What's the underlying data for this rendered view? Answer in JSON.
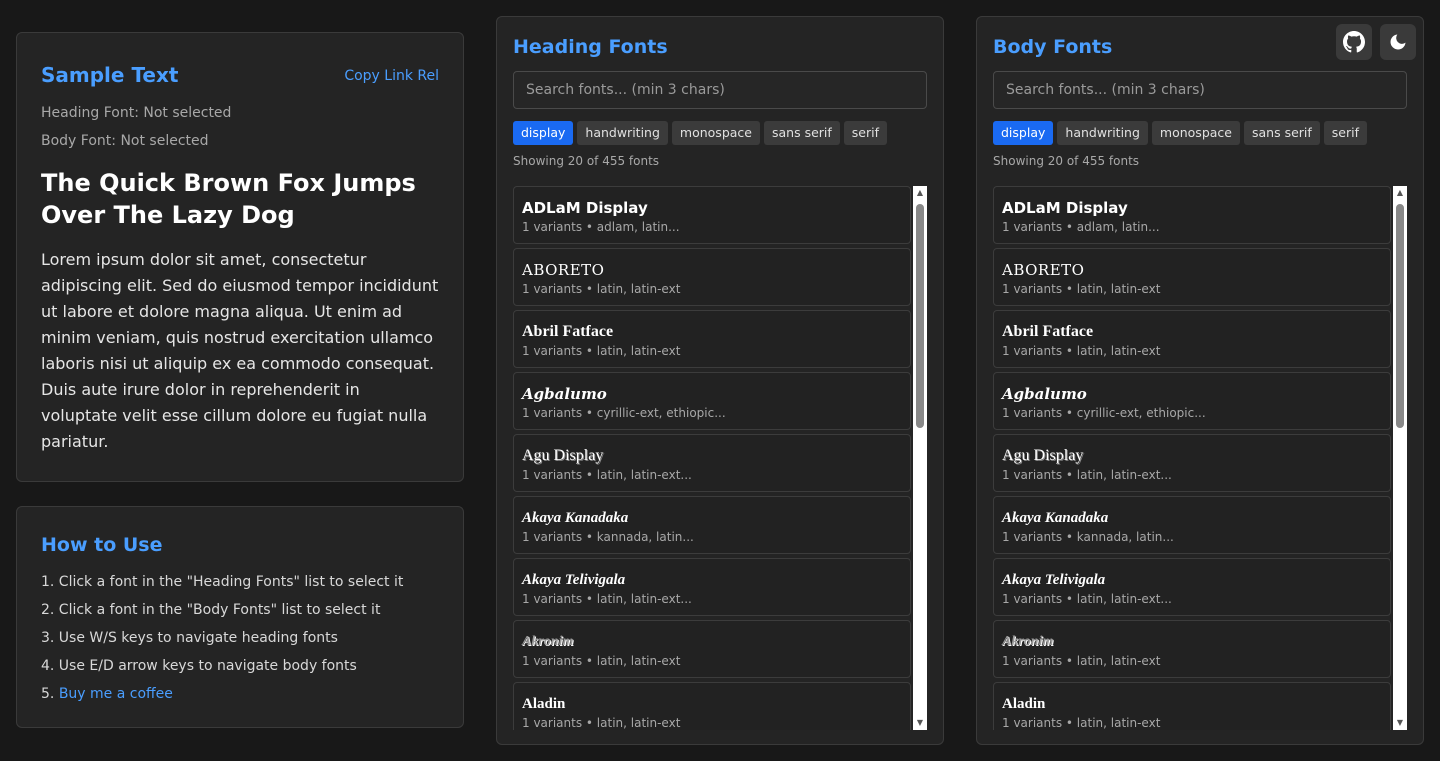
{
  "sample": {
    "title": "Sample Text",
    "copy_link": "Copy Link Rel",
    "heading_font": "Heading Font: Not selected",
    "body_font": "Body Font: Not selected",
    "heading_text": "The Quick Brown Fox Jumps Over The Lazy Dog",
    "body_text": "Lorem ipsum dolor sit amet, consectetur adipiscing elit. Sed do eiusmod tempor incididunt ut labore et dolore magna aliqua. Ut enim ad minim veniam, quis nostrud exercitation ullamco laboris nisi ut aliquip ex ea commodo consequat. Duis aute irure dolor in reprehenderit in voluptate velit esse cillum dolore eu fugiat nulla pariatur."
  },
  "howto": {
    "title": "How to Use",
    "steps": [
      "1. Click a font in the \"Heading Fonts\" list to select it",
      "2. Click a font in the \"Body Fonts\" list to select it",
      "3. Use W/S keys to navigate heading fonts",
      "4. Use E/D arrow keys to navigate body fonts"
    ],
    "step5_prefix": "5. ",
    "step5_link": "Buy me a coffee"
  },
  "heading_panel": {
    "title": "Heading Fonts",
    "search_placeholder": "Search fonts... (min 3 chars)",
    "count": "Showing 20 of 455 fonts"
  },
  "body_panel": {
    "title": "Body Fonts",
    "search_placeholder": "Search fonts... (min 3 chars)",
    "count": "Showing 20 of 455 fonts"
  },
  "categories": [
    {
      "label": "display",
      "active": true
    },
    {
      "label": "handwriting",
      "active": false
    },
    {
      "label": "monospace",
      "active": false
    },
    {
      "label": "sans serif",
      "active": false
    },
    {
      "label": "serif",
      "active": false
    }
  ],
  "fonts": [
    {
      "name": "ADLaM Display",
      "meta": "1 variants • adlam, latin...",
      "style": "plain"
    },
    {
      "name": "ABORETO",
      "meta": "1 variants • latin, latin-ext",
      "style": "serif"
    },
    {
      "name": "Abril Fatface",
      "meta": "1 variants • latin, latin-ext",
      "style": "fatface"
    },
    {
      "name": "Agbalumo",
      "meta": "1 variants • cyrillic-ext, ethiopic...",
      "style": "italic"
    },
    {
      "name": "Agu Display",
      "meta": "1 variants • latin, latin-ext...",
      "style": "shadow"
    },
    {
      "name": "Akaya Kanadaka",
      "meta": "1 variants • kannada, latin...",
      "style": "script"
    },
    {
      "name": "Akaya Telivigala",
      "meta": "1 variants • latin, latin-ext...",
      "style": "script"
    },
    {
      "name": "Akronim",
      "meta": "1 variants • latin, latin-ext",
      "style": "outline"
    },
    {
      "name": "Aladin",
      "meta": "1 variants • latin, latin-ext",
      "style": "narrow"
    }
  ],
  "icons": {
    "github": "github-icon",
    "theme": "moon-icon"
  },
  "colors": {
    "accent": "#4a9eff",
    "active_chip": "#1a6af2",
    "background": "#181818",
    "card": "#242424"
  }
}
